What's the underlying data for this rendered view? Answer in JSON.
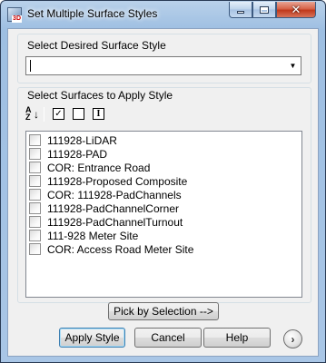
{
  "window": {
    "title": "Set Multiple Surface Styles",
    "app_icon_badge": "3D"
  },
  "titlebar_buttons": {
    "minimize_icon": "minimize-icon",
    "maximize_icon": "maximize-icon",
    "close_icon": "close-icon",
    "close_glyph": "✕"
  },
  "style_group": {
    "label": "Select Desired Surface Style",
    "combo_value": "",
    "dropdown_glyph": "▼"
  },
  "surfaces_group": {
    "label": "Select Surfaces to Apply Style",
    "toolbar": {
      "sort_glyph_top": "A",
      "sort_glyph_bottom": "Z",
      "sort_arrow": "↓",
      "check_all_glyph": "✓",
      "uncheck_all_glyph": "",
      "invert_glyph": "I"
    },
    "items": [
      {
        "label": "111928-LiDAR",
        "checked": false
      },
      {
        "label": "111928-PAD",
        "checked": false
      },
      {
        "label": "COR: Entrance Road",
        "checked": false
      },
      {
        "label": "111928-Proposed Composite",
        "checked": false
      },
      {
        "label": "COR: 111928-PadChannels",
        "checked": false
      },
      {
        "label": "111928-PadChannelCorner",
        "checked": false
      },
      {
        "label": "111928-PadChannelTurnout",
        "checked": false
      },
      {
        "label": "111-928 Meter Site",
        "checked": false
      },
      {
        "label": "COR: Access Road Meter Site",
        "checked": false
      }
    ]
  },
  "buttons": {
    "pick_by_selection": "Pick by Selection -->",
    "apply_style": "Apply Style",
    "cancel": "Cancel",
    "help": "Help",
    "more_glyph": "›"
  },
  "colors": {
    "titlebar": "#a9c6e6",
    "close_button": "#c0391c",
    "dialog_bg": "#f0f0f0"
  }
}
